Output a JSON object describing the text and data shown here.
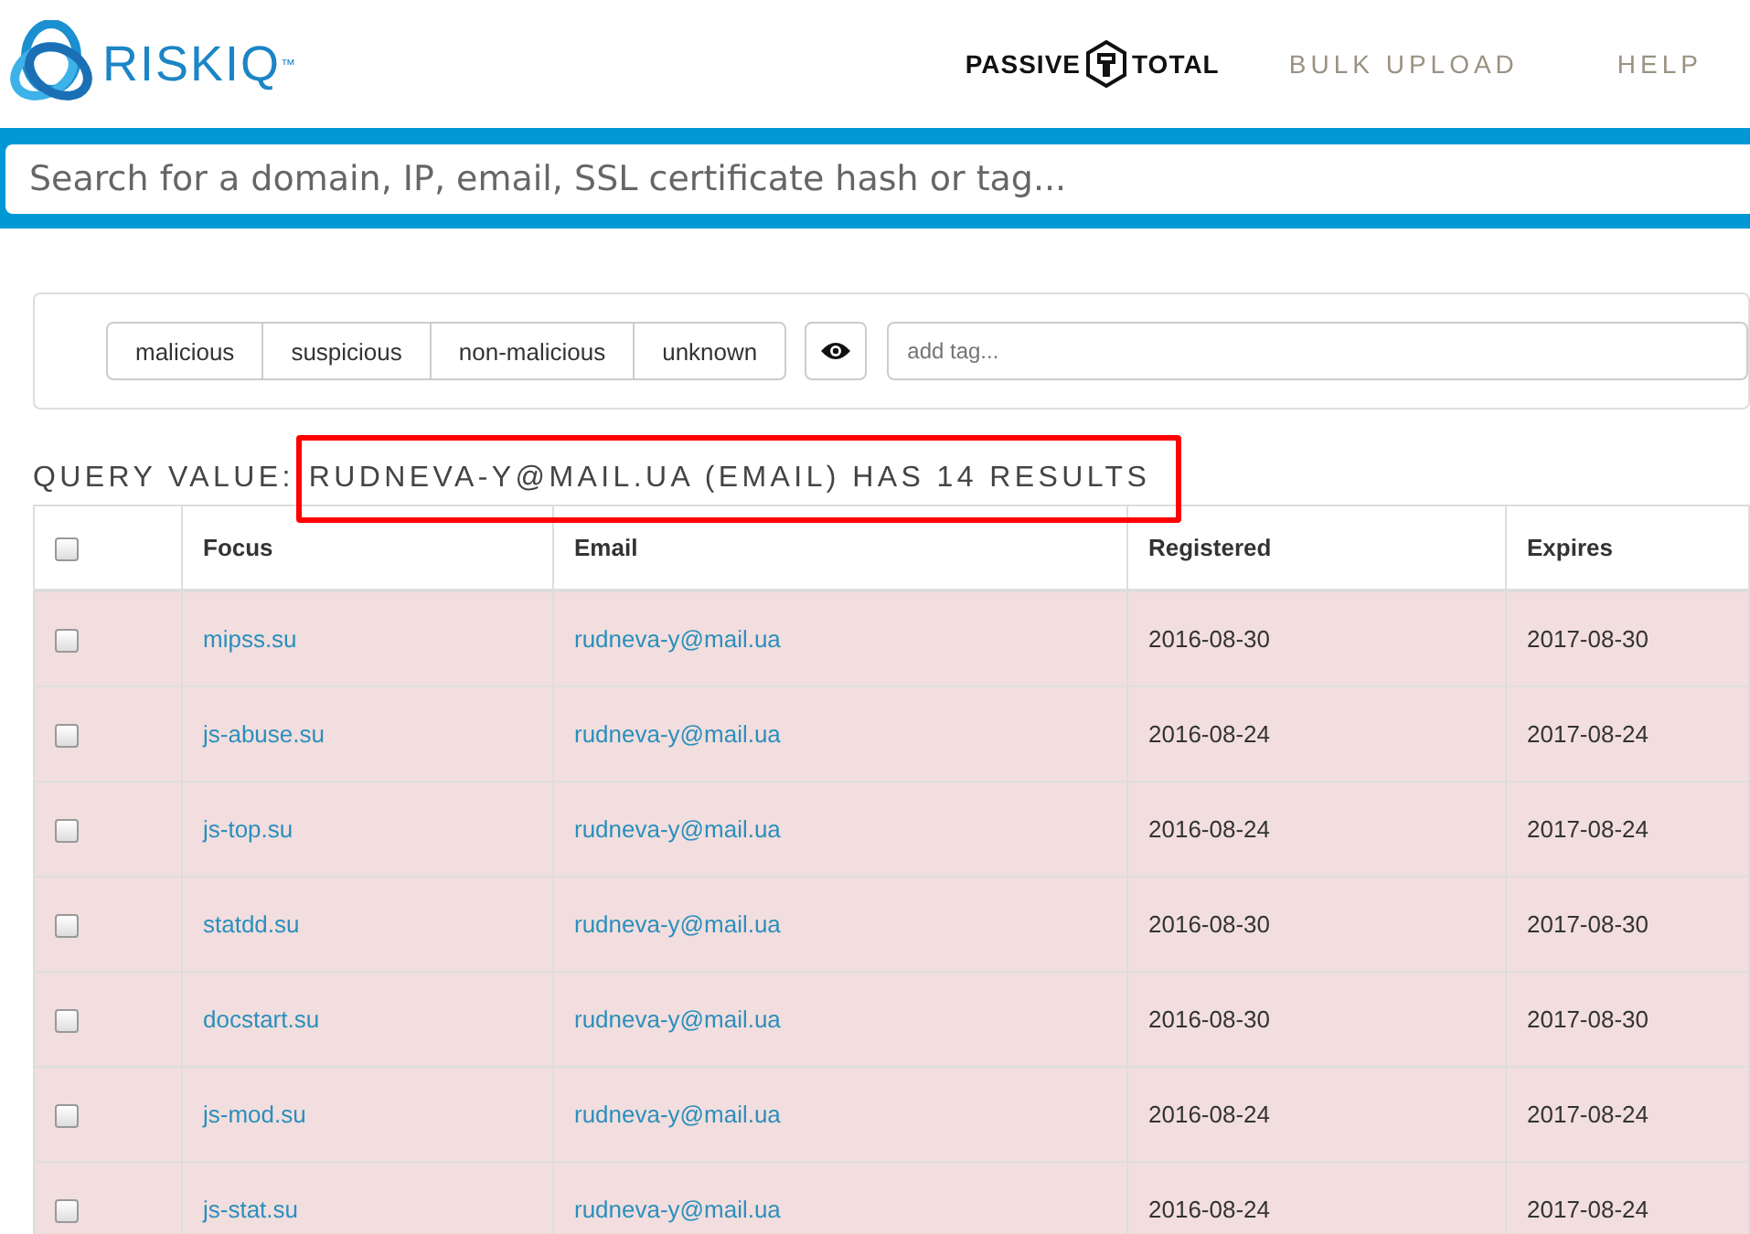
{
  "header": {
    "logo_text": "RISKIQ",
    "logo_mark": "™",
    "product": [
      "PASSIVE",
      "TOTAL"
    ],
    "nav": [
      {
        "label": "BULK UPLOAD"
      },
      {
        "label": "HELP"
      }
    ]
  },
  "search": {
    "placeholder": "Search for a domain, IP, email, SSL certificate hash or tag..."
  },
  "classify": {
    "options": [
      {
        "label": "malicious",
        "selected": false
      },
      {
        "label": "suspicious",
        "selected": false
      },
      {
        "label": "non-malicious",
        "selected": false
      },
      {
        "label": "unknown",
        "selected": false
      }
    ],
    "tag_placeholder": "add tag..."
  },
  "query": {
    "label": "QUERY VALUE:",
    "value": "RUDNEVA-Y@MAIL.UA (EMAIL) HAS 14 RESULTS",
    "highlighted": true
  },
  "table": {
    "columns": [
      "Focus",
      "Email",
      "Registered",
      "Expires"
    ],
    "all_checked": false,
    "rows": [
      {
        "checked": false,
        "focus": "mipss.su",
        "email": "rudneva-y@mail.ua",
        "registered": "2016-08-30",
        "expires": "2017-08-30"
      },
      {
        "checked": false,
        "focus": "js-abuse.su",
        "email": "rudneva-y@mail.ua",
        "registered": "2016-08-24",
        "expires": "2017-08-24"
      },
      {
        "checked": false,
        "focus": "js-top.su",
        "email": "rudneva-y@mail.ua",
        "registered": "2016-08-24",
        "expires": "2017-08-24"
      },
      {
        "checked": false,
        "focus": "statdd.su",
        "email": "rudneva-y@mail.ua",
        "registered": "2016-08-30",
        "expires": "2017-08-30"
      },
      {
        "checked": false,
        "focus": "docstart.su",
        "email": "rudneva-y@mail.ua",
        "registered": "2016-08-30",
        "expires": "2017-08-30"
      },
      {
        "checked": false,
        "focus": "js-mod.su",
        "email": "rudneva-y@mail.ua",
        "registered": "2016-08-24",
        "expires": "2017-08-24"
      },
      {
        "checked": false,
        "focus": "js-stat.su",
        "email": "rudneva-y@mail.ua",
        "registered": "2016-08-24",
        "expires": "2017-08-24"
      }
    ]
  }
}
